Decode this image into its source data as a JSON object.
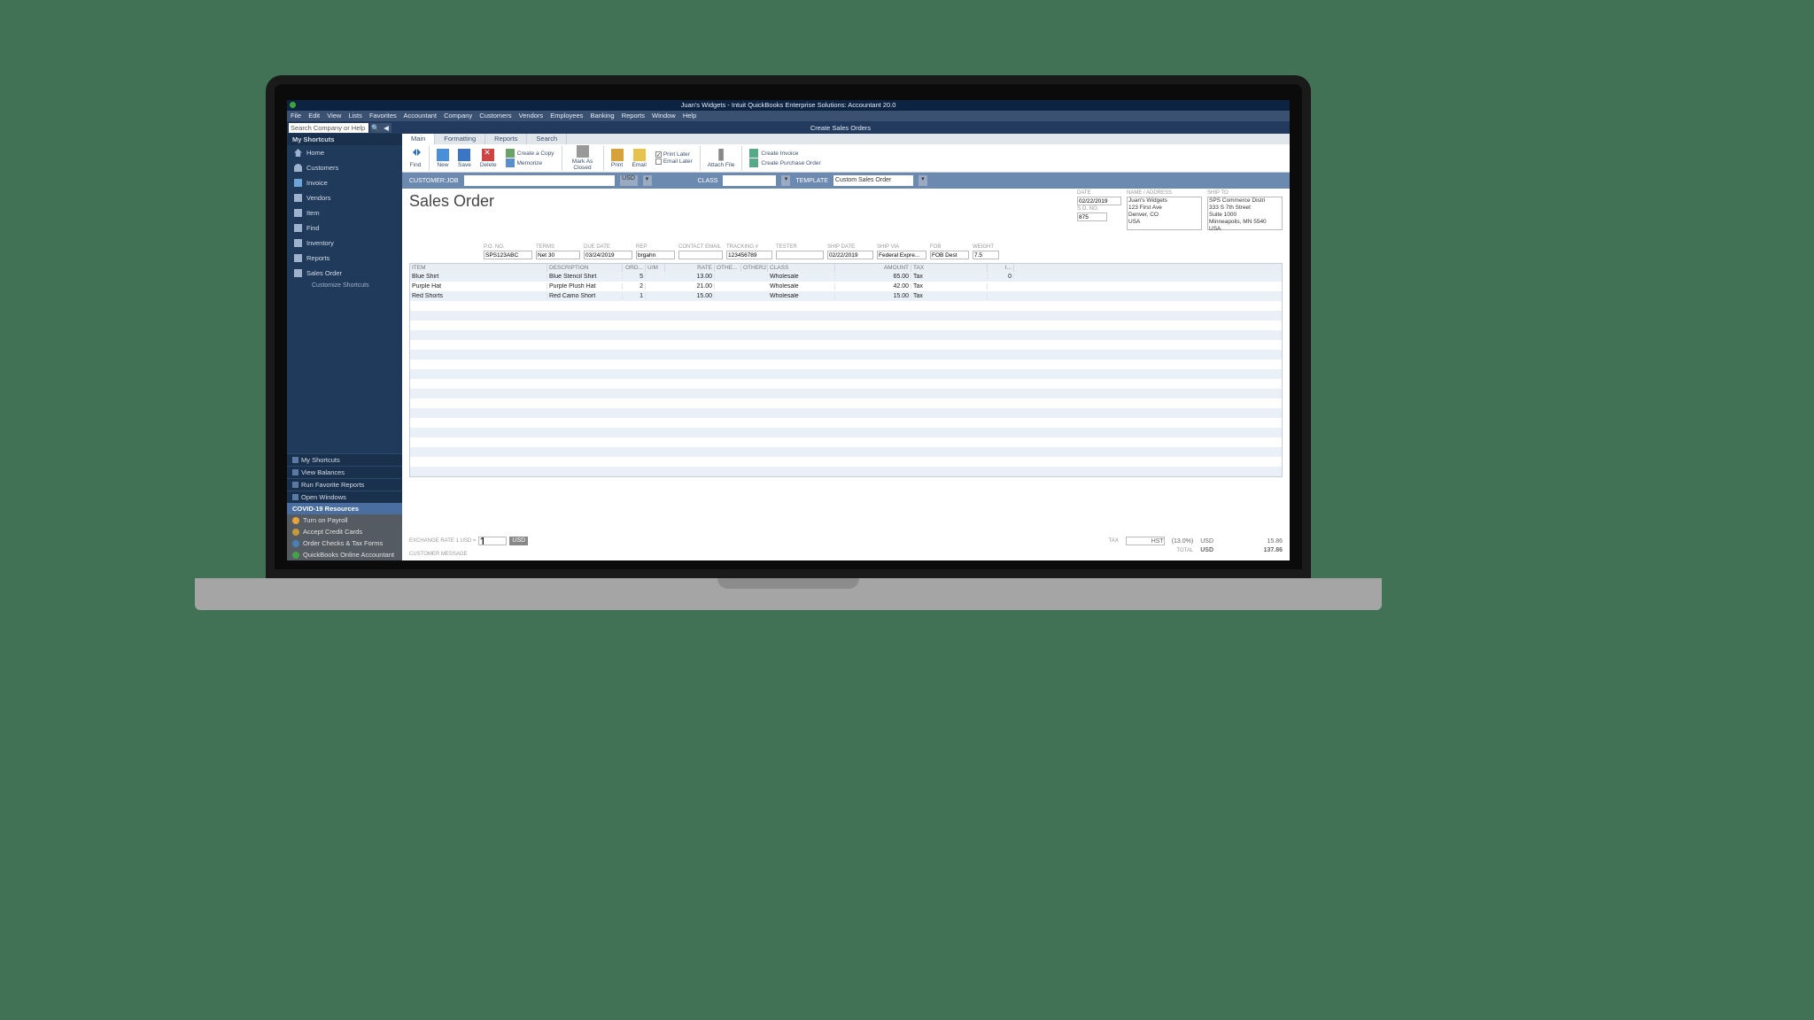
{
  "title": "Juan's Widgets  - Intuit QuickBooks Enterprise Solutions: Accountant 20.0",
  "menus": [
    "File",
    "Edit",
    "View",
    "Lists",
    "Favorites",
    "Accountant",
    "Company",
    "Customers",
    "Vendors",
    "Employees",
    "Banking",
    "Reports",
    "Window",
    "Help"
  ],
  "search_placeholder": "Search Company or Help",
  "window_title": "Create Sales Orders",
  "tabs": [
    "Main",
    "Formatting",
    "Reports",
    "Search"
  ],
  "ribbon": {
    "find": "Find",
    "new": "New",
    "save": "Save",
    "delete": "Delete",
    "create_copy": "Create a Copy",
    "memorize": "Memorize",
    "mark_closed": "Mark As Closed",
    "print": "Print",
    "email": "Email",
    "print_later": "Print Later",
    "email_later": "Email Later",
    "attach": "Attach File",
    "create_invoice": "Create Invoice",
    "create_po": "Create Purchase Order"
  },
  "cjbar": {
    "customer_label": "CUSTOMER:JOB",
    "currency": "USD",
    "class_label": "CLASS",
    "template_label": "TEMPLATE",
    "template_value": "Custom Sales Order"
  },
  "heading": "Sales Order",
  "meta": {
    "date_label": "DATE",
    "date": "02/22/2019",
    "so_label": "S.O. NO.",
    "so": "875",
    "name_label": "NAME / ADDRESS",
    "name_addr": "Juan's Widgets\n123 First Ave\nDenver, CO\nUSA",
    "ship_label": "SHIP TO",
    "ship_addr": "SPS Commerce Distri\n333 S 7th Street\nSuite 1000\nMinneapolis, MN 5540\nUSA"
  },
  "row2": {
    "po_label": "P.O. NO.",
    "po": "SPS123ABC",
    "terms_label": "TERMS",
    "terms": "Net 30",
    "due_label": "DUE DATE",
    "due": "03/24/2019",
    "rep_label": "REP",
    "rep": "brgahn",
    "contact_label": "CONTACT EMAIL",
    "tracking_label": "TRACKING #",
    "tracking": "123456789",
    "tester_label": "TESTER",
    "shipdate_label": "SHIP DATE",
    "shipdate": "02/22/2019",
    "shipvia_label": "SHIP VIA",
    "shipvia": "Federal Expre...",
    "fob_label": "FOB",
    "fob": "FOB Dest",
    "weight_label": "WEIGHT",
    "weight": "7.5"
  },
  "grid": {
    "headers": {
      "item": "ITEM",
      "desc": "DESCRIPTION",
      "ord": "ORD...",
      "um": "U/M",
      "rate": "RATE",
      "oth": "OTHE...",
      "oth2": "OTHER2",
      "cls": "CLASS",
      "amt": "AMOUNT",
      "tax": "TAX",
      "i": "I..."
    },
    "rows": [
      {
        "item": "Blue Shirt",
        "desc": "Blue Stencil Shirt",
        "ord": "5",
        "rate": "13.00",
        "cls": "Wholesale",
        "amt": "65.00",
        "tax": "Tax",
        "i": "0"
      },
      {
        "item": "Purple Hat",
        "desc": "Purple Plush Hat",
        "ord": "2",
        "rate": "21.00",
        "cls": "Wholesale",
        "amt": "42.00",
        "tax": "Tax",
        "i": ""
      },
      {
        "item": "Red Shorts",
        "desc": "Red Camo Short",
        "ord": "1",
        "rate": "15.00",
        "cls": "Wholesale",
        "amt": "15.00",
        "tax": "Tax",
        "i": ""
      }
    ]
  },
  "footer": {
    "ex_label": "EXCHANGE RATE 1 USD =",
    "ex_val": "1",
    "ex_unit": "USD",
    "msg_label": "CUSTOMER MESSAGE",
    "tax_label": "TAX",
    "tax_code": "HST",
    "tax_pct": "(13.0%)",
    "tax_cur": "USD",
    "tax_amt": "15.86",
    "total_label": "TOTAL",
    "total_cur": "USD",
    "total_amt": "137.86"
  },
  "sidebar": {
    "head": "My Shortcuts",
    "items": [
      "Home",
      "Customers",
      "Invoice",
      "Vendors",
      "Item",
      "Find",
      "Inventory",
      "Reports",
      "Sales Order"
    ],
    "customize": "Customize Shortcuts",
    "bottom": [
      "My Shortcuts",
      "View Balances",
      "Run Favorite Reports",
      "Open Windows"
    ],
    "covid": "COVID-19 Resources",
    "covid_items": [
      "Turn on Payroll",
      "Accept Credit Cards",
      "Order Checks & Tax Forms",
      "QuickBooks Online Accountant"
    ]
  }
}
